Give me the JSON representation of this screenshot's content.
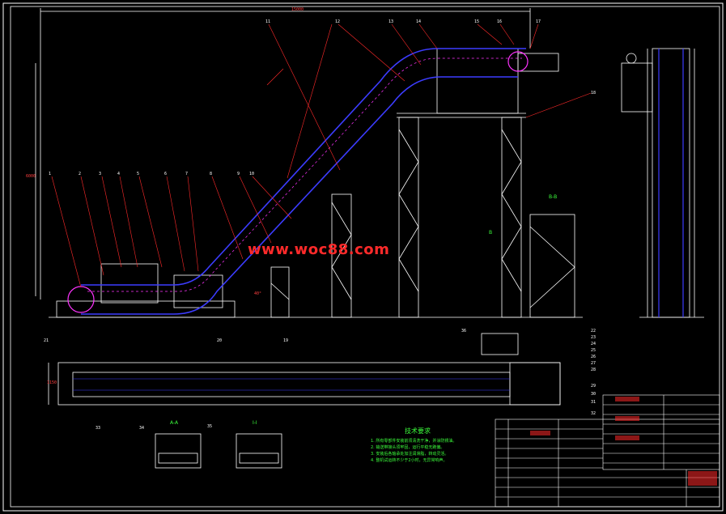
{
  "watermark": "www.woc88.com",
  "dimensions": {
    "top_length": "15000",
    "height": "6000",
    "width": "1150",
    "angle": "40°"
  },
  "section_labels": {
    "bb": "B-B",
    "b_marker": "B",
    "aa": "A-A",
    "ii": "I-I"
  },
  "notes": {
    "title": "技术要求",
    "lines": [
      "1. 所有零部件安装前须清洗干净，并涂防锈油。",
      "2. 输送带接头须牢固，运行平稳无跑偏。",
      "3. 安装后各轴承处加注润滑脂，转动灵活。",
      "4. 整机试运转不少于2小时，无异常响声。"
    ]
  },
  "part_numbers": [
    "1",
    "2",
    "3",
    "4",
    "5",
    "6",
    "7",
    "8",
    "9",
    "10",
    "11",
    "12",
    "13",
    "14",
    "15",
    "16",
    "17",
    "18",
    "19",
    "20",
    "21",
    "22",
    "23",
    "24",
    "25",
    "26",
    "27",
    "28",
    "29",
    "30",
    "31",
    "32",
    "33",
    "34",
    "35",
    "36"
  ],
  "colors": {
    "background": "#000000",
    "line": "#ffffff",
    "belt": "#3c3cff",
    "leader": "#ff2a2a",
    "text_green": "#3cff3c",
    "cyan": "#00e5ff",
    "magenta": "#ff33ff"
  }
}
